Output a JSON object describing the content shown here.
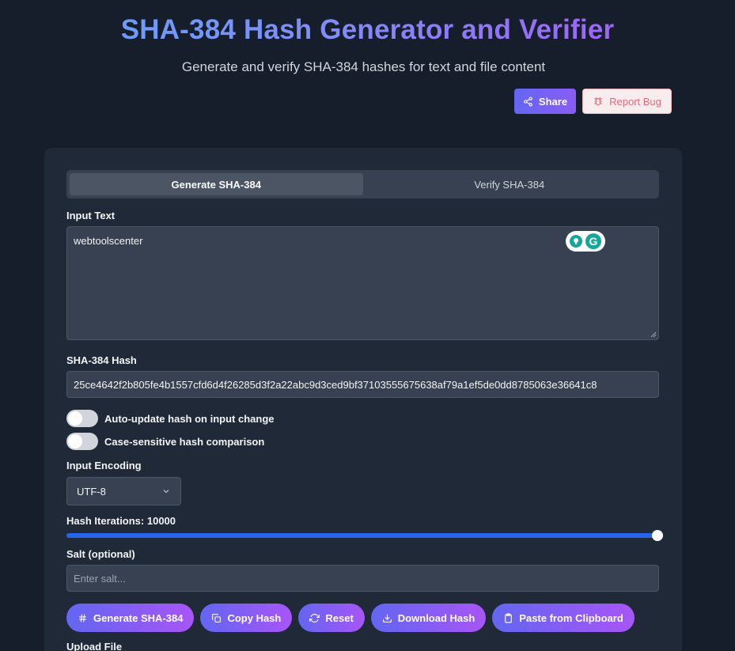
{
  "header": {
    "title": "SHA-384 Hash Generator and Verifier",
    "subtitle": "Generate and verify SHA-384 hashes for text and file content",
    "share_label": "Share",
    "report_bug_label": "Report Bug"
  },
  "tabs": [
    {
      "label": "Generate SHA-384",
      "active": true
    },
    {
      "label": "Verify SHA-384",
      "active": false
    }
  ],
  "input": {
    "label": "Input Text",
    "value": "webtoolscenter"
  },
  "hash": {
    "label": "SHA-384 Hash",
    "value": "25ce4642f2b805fe4b1557cfd6d4f26285d3f2a22abc9d3ced9bf37103555675638af79a1ef5de0dd8785063e36641c8"
  },
  "toggles": [
    {
      "label": "Auto-update hash on input change",
      "on": false
    },
    {
      "label": "Case-sensitive hash comparison",
      "on": false
    }
  ],
  "encoding": {
    "label": "Input Encoding",
    "selected": "UTF-8"
  },
  "iterations": {
    "label": "Hash Iterations: 10000",
    "value": 10000,
    "fill_fraction": 1.0
  },
  "salt": {
    "label": "Salt (optional)",
    "placeholder": "Enter salt..."
  },
  "actions": {
    "generate": "Generate SHA-384",
    "copy": "Copy Hash",
    "reset": "Reset",
    "download": "Download Hash",
    "paste": "Paste from Clipboard"
  },
  "upload": {
    "label": "Upload File"
  },
  "icons": [
    "share-icon",
    "bug-icon",
    "hash-icon",
    "copy-icon",
    "refresh-icon",
    "download-icon",
    "clipboard-icon",
    "chevron-down-icon",
    "grammarly-icon"
  ],
  "colors": {
    "background": "#171e2b",
    "panel": "#1f2937",
    "accent_start": "#6366f1",
    "accent_end": "#a855f7",
    "slider": "#2563eb"
  }
}
